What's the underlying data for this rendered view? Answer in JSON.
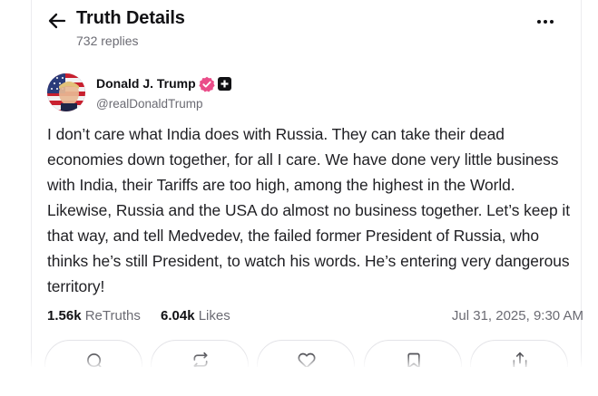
{
  "header": {
    "back_icon": "arrow-left-icon",
    "title": "Truth Details",
    "reply_count": "732 replies",
    "more_icon": "more-horizontal-icon"
  },
  "post": {
    "author": {
      "name": "Donald J. Trump",
      "handle": "@realDonaldTrump",
      "verified_icon": "verified-badge-icon",
      "plus_icon": "plus-badge-icon",
      "verified_color": "#ea4c89"
    },
    "text": "I don’t care what India does with Russia. They can take their dead economies down together, for all I care. We have done very little business with India, their Tariffs are too high, among the highest in the World. Likewise, Russia and the USA do almost no business together. Let’s keep it that way, and tell Medvedev, the failed former President of Russia, who thinks he’s still President, to watch his words. He’s entering very dangerous territory!",
    "stats": {
      "retruths_value": "1.56k",
      "retruths_label": "ReTruths",
      "likes_value": "6.04k",
      "likes_label": "Likes"
    },
    "timestamp": "Jul 31, 2025, 9:30 AM"
  },
  "actions": [
    {
      "name": "reply",
      "icon": "reply-icon"
    },
    {
      "name": "retruth",
      "icon": "retruth-icon"
    },
    {
      "name": "like",
      "icon": "heart-icon"
    },
    {
      "name": "bookmark",
      "icon": "bookmark-icon"
    },
    {
      "name": "share",
      "icon": "share-icon"
    }
  ]
}
